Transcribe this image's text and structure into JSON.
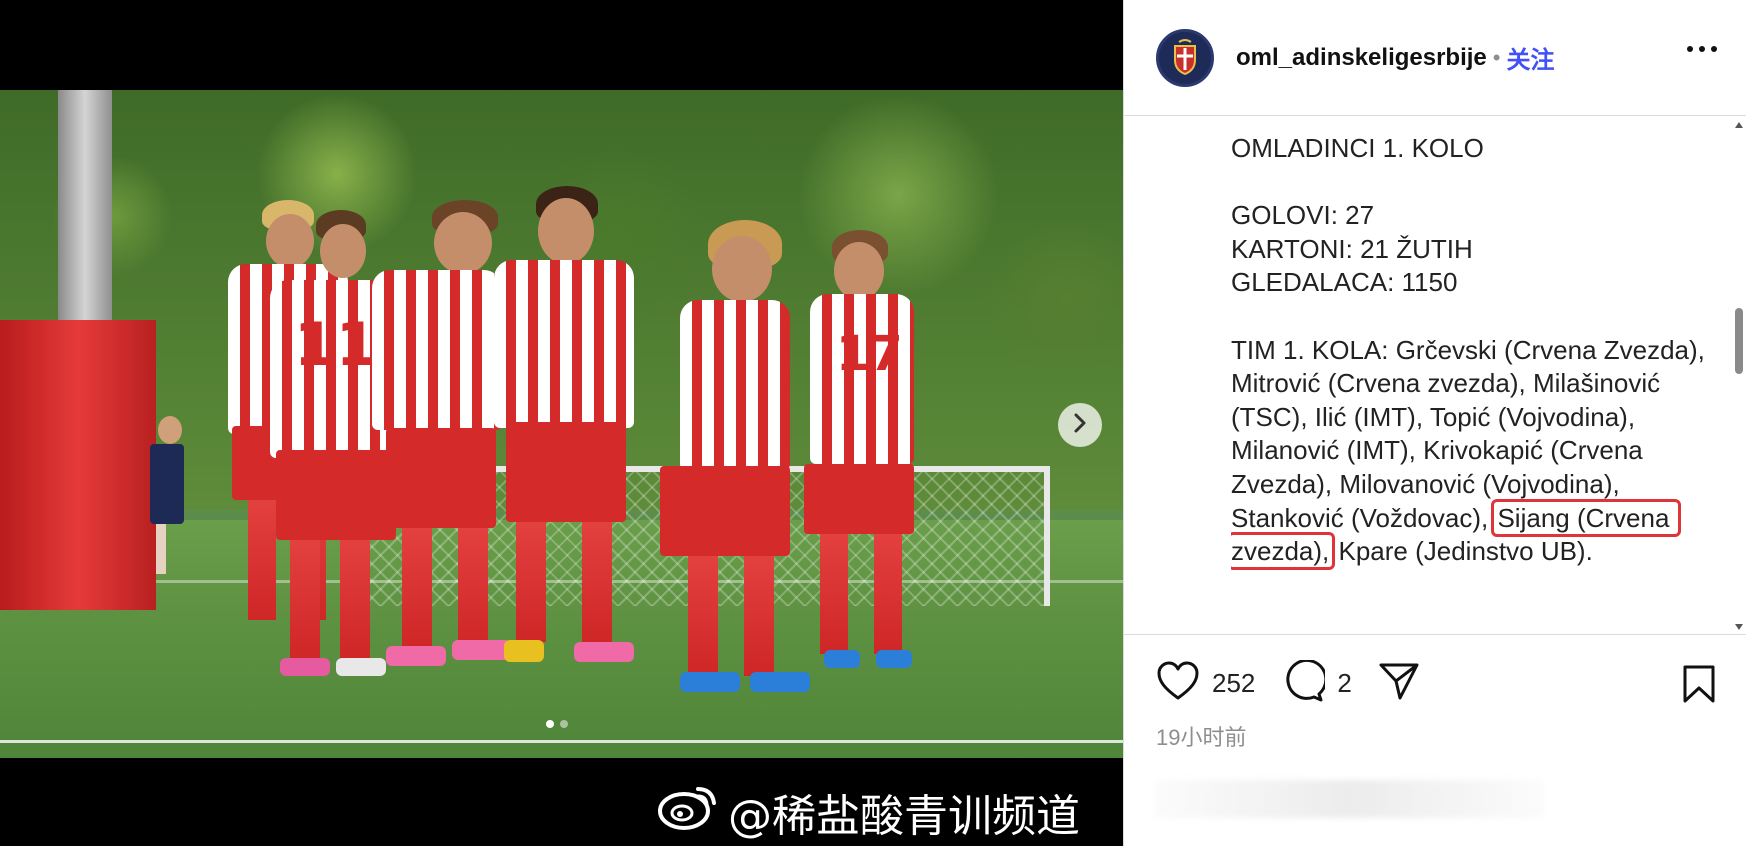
{
  "post": {
    "username": "oml_adinskeligesrbije",
    "separator": "•",
    "follow_label": "关注",
    "caption": {
      "line1": "OMLADINCI 1. KOLO",
      "line2": "GOLOVI: 27",
      "line3": "KARTONI: 21 ŽUTIH",
      "line4": "GLEDALACA: 1150",
      "team_part1": "TIM 1. KOLA: Grčevski (Crvena Zvezda), Mitrović (Crvena zvezda), Milašinović (TSC), Ilić (IMT), Topić (Vojvodina), Milanović (IMT), Krivokapić (Crvena Zvezda), Milovanović (Vojvodina), Stanković (Voždovac), ",
      "team_highlight": "Sijang (Crvena zvezda),",
      "team_part2": " Kpare (Jedinstvo UB)."
    },
    "likes": "252",
    "comments": "2",
    "timestamp": "19小时前"
  },
  "media": {
    "watermark": "@稀盐酸青训频道",
    "jersey_numbers": [
      "11",
      "17"
    ],
    "carousel": {
      "count": 2,
      "active": 0
    }
  },
  "colors": {
    "follow": "#4150f7",
    "highlight_box": "#e0343b",
    "kit_red": "#d42a2a"
  },
  "icons": [
    "chevron-right-icon",
    "more-icon",
    "heart-icon",
    "comment-icon",
    "share-icon",
    "bookmark-icon",
    "weibo-icon"
  ]
}
